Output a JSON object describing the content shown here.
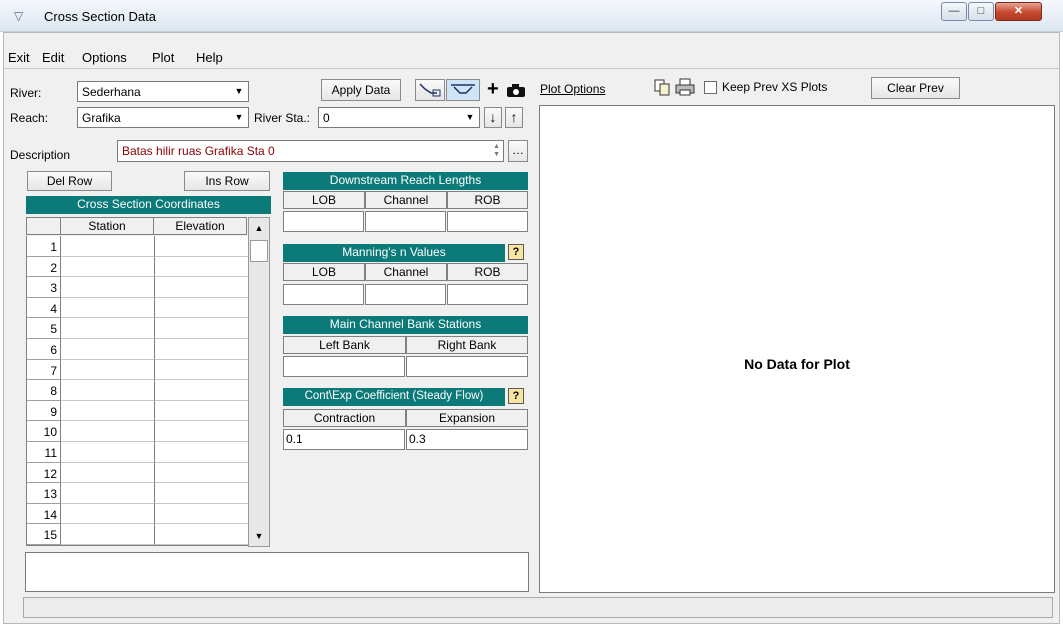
{
  "window": {
    "title": "Cross Section Data"
  },
  "menu": [
    "Exit",
    "Edit",
    "Options",
    "Plot",
    "Help"
  ],
  "form": {
    "river_label": "River:",
    "river_value": "Sederhana",
    "reach_label": "Reach:",
    "reach_value": "Grafika",
    "river_sta_label": "River Sta.:",
    "river_sta_value": "0",
    "description_label": "Description",
    "description_value": "Batas hilir ruas Grafika Sta 0",
    "apply_data": "Apply Data",
    "del_row": "Del Row",
    "ins_row": "Ins Row",
    "plus": "+"
  },
  "coords": {
    "title": "Cross Section Coordinates",
    "columns": [
      "Station",
      "Elevation"
    ],
    "rows": [
      "1",
      "2",
      "3",
      "4",
      "5",
      "6",
      "7",
      "8",
      "9",
      "10",
      "11",
      "12",
      "13",
      "14",
      "15"
    ]
  },
  "reach_lengths": {
    "title": "Downstream Reach Lengths",
    "columns": [
      "LOB",
      "Channel",
      "ROB"
    ],
    "values": [
      "",
      "",
      ""
    ]
  },
  "mannings": {
    "title": "Manning's n Values",
    "columns": [
      "LOB",
      "Channel",
      "ROB"
    ],
    "values": [
      "",
      "",
      ""
    ]
  },
  "bank": {
    "title": "Main Channel Bank Stations",
    "columns": [
      "Left Bank",
      "Right Bank"
    ],
    "values": [
      "",
      ""
    ]
  },
  "coef": {
    "title": "Cont\\Exp Coefficient (Steady Flow)",
    "columns": [
      "Contraction",
      "Expansion"
    ],
    "values": [
      "0.1",
      "0.3"
    ]
  },
  "plot": {
    "options": "Plot Options",
    "keep_prev": "Keep Prev XS Plots",
    "clear_prev": "Clear Prev",
    "empty": "No Data for Plot"
  },
  "help": "?",
  "colors": {
    "header_teal": "#0b7a78",
    "description_text": "#8b0000"
  }
}
